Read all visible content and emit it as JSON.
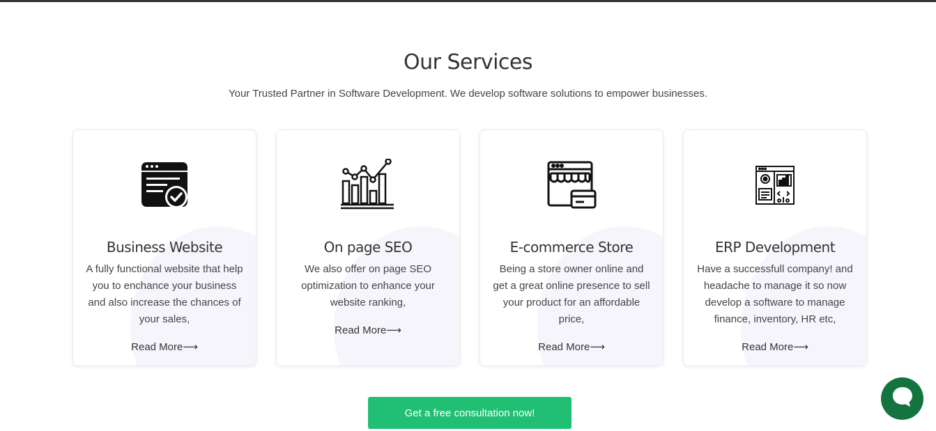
{
  "header": {
    "title": "Our Services",
    "subtitle": "Your Trusted Partner in Software Development. We develop software solutions to empower businesses."
  },
  "services": [
    {
      "icon": "browser-check-icon",
      "title": "Business Website",
      "description": "A fully functional website that help you to enchance your business and also increase the chances of your sales,",
      "link": "Read More⟶"
    },
    {
      "icon": "seo-chart-icon",
      "title": "On page SEO",
      "description": "We also offer on page SEO optimization to enhance your website ranking,",
      "link": "Read More⟶"
    },
    {
      "icon": "store-card-icon",
      "title": "E-commerce Store",
      "description": "Being a store owner online and get a great online presence to sell your product for an affordable price,",
      "link": "Read More⟶"
    },
    {
      "icon": "erp-dashboard-icon",
      "title": "ERP Development",
      "description": "Have a successfull company! and headache to manage it so now develop a software to manage finance, inventory, HR etc,",
      "link": "Read More⟶"
    }
  ],
  "cta": {
    "label": "Get a free consultation now!"
  },
  "chat": {
    "icon": "chat-bubble-icon"
  },
  "colors": {
    "cta": "#21bf73",
    "chat": "#13743f",
    "text": "#333333"
  }
}
